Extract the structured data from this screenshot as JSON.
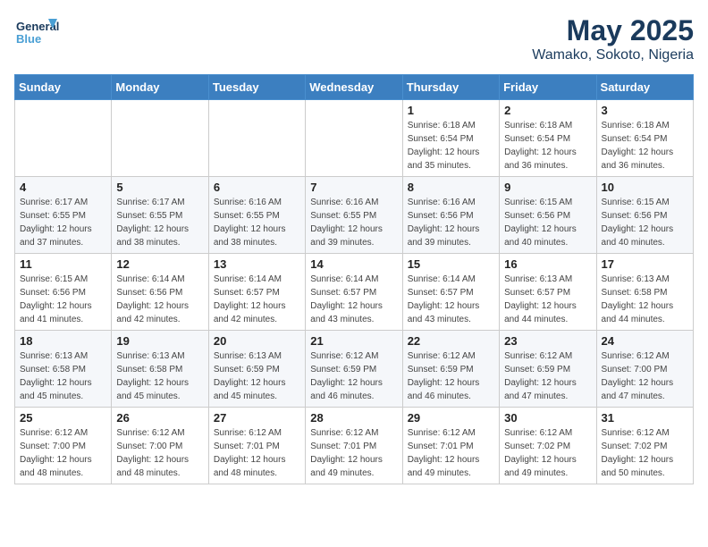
{
  "header": {
    "logo_general": "General",
    "logo_blue": "Blue",
    "month_year": "May 2025",
    "location": "Wamako, Sokoto, Nigeria"
  },
  "weekdays": [
    "Sunday",
    "Monday",
    "Tuesday",
    "Wednesday",
    "Thursday",
    "Friday",
    "Saturday"
  ],
  "weeks": [
    [
      {
        "day": "",
        "sunrise": "",
        "sunset": "",
        "daylight": ""
      },
      {
        "day": "",
        "sunrise": "",
        "sunset": "",
        "daylight": ""
      },
      {
        "day": "",
        "sunrise": "",
        "sunset": "",
        "daylight": ""
      },
      {
        "day": "",
        "sunrise": "",
        "sunset": "",
        "daylight": ""
      },
      {
        "day": "1",
        "sunrise": "Sunrise: 6:18 AM",
        "sunset": "Sunset: 6:54 PM",
        "daylight": "Daylight: 12 hours and 35 minutes."
      },
      {
        "day": "2",
        "sunrise": "Sunrise: 6:18 AM",
        "sunset": "Sunset: 6:54 PM",
        "daylight": "Daylight: 12 hours and 36 minutes."
      },
      {
        "day": "3",
        "sunrise": "Sunrise: 6:18 AM",
        "sunset": "Sunset: 6:54 PM",
        "daylight": "Daylight: 12 hours and 36 minutes."
      }
    ],
    [
      {
        "day": "4",
        "sunrise": "Sunrise: 6:17 AM",
        "sunset": "Sunset: 6:55 PM",
        "daylight": "Daylight: 12 hours and 37 minutes."
      },
      {
        "day": "5",
        "sunrise": "Sunrise: 6:17 AM",
        "sunset": "Sunset: 6:55 PM",
        "daylight": "Daylight: 12 hours and 38 minutes."
      },
      {
        "day": "6",
        "sunrise": "Sunrise: 6:16 AM",
        "sunset": "Sunset: 6:55 PM",
        "daylight": "Daylight: 12 hours and 38 minutes."
      },
      {
        "day": "7",
        "sunrise": "Sunrise: 6:16 AM",
        "sunset": "Sunset: 6:55 PM",
        "daylight": "Daylight: 12 hours and 39 minutes."
      },
      {
        "day": "8",
        "sunrise": "Sunrise: 6:16 AM",
        "sunset": "Sunset: 6:56 PM",
        "daylight": "Daylight: 12 hours and 39 minutes."
      },
      {
        "day": "9",
        "sunrise": "Sunrise: 6:15 AM",
        "sunset": "Sunset: 6:56 PM",
        "daylight": "Daylight: 12 hours and 40 minutes."
      },
      {
        "day": "10",
        "sunrise": "Sunrise: 6:15 AM",
        "sunset": "Sunset: 6:56 PM",
        "daylight": "Daylight: 12 hours and 40 minutes."
      }
    ],
    [
      {
        "day": "11",
        "sunrise": "Sunrise: 6:15 AM",
        "sunset": "Sunset: 6:56 PM",
        "daylight": "Daylight: 12 hours and 41 minutes."
      },
      {
        "day": "12",
        "sunrise": "Sunrise: 6:14 AM",
        "sunset": "Sunset: 6:56 PM",
        "daylight": "Daylight: 12 hours and 42 minutes."
      },
      {
        "day": "13",
        "sunrise": "Sunrise: 6:14 AM",
        "sunset": "Sunset: 6:57 PM",
        "daylight": "Daylight: 12 hours and 42 minutes."
      },
      {
        "day": "14",
        "sunrise": "Sunrise: 6:14 AM",
        "sunset": "Sunset: 6:57 PM",
        "daylight": "Daylight: 12 hours and 43 minutes."
      },
      {
        "day": "15",
        "sunrise": "Sunrise: 6:14 AM",
        "sunset": "Sunset: 6:57 PM",
        "daylight": "Daylight: 12 hours and 43 minutes."
      },
      {
        "day": "16",
        "sunrise": "Sunrise: 6:13 AM",
        "sunset": "Sunset: 6:57 PM",
        "daylight": "Daylight: 12 hours and 44 minutes."
      },
      {
        "day": "17",
        "sunrise": "Sunrise: 6:13 AM",
        "sunset": "Sunset: 6:58 PM",
        "daylight": "Daylight: 12 hours and 44 minutes."
      }
    ],
    [
      {
        "day": "18",
        "sunrise": "Sunrise: 6:13 AM",
        "sunset": "Sunset: 6:58 PM",
        "daylight": "Daylight: 12 hours and 45 minutes."
      },
      {
        "day": "19",
        "sunrise": "Sunrise: 6:13 AM",
        "sunset": "Sunset: 6:58 PM",
        "daylight": "Daylight: 12 hours and 45 minutes."
      },
      {
        "day": "20",
        "sunrise": "Sunrise: 6:13 AM",
        "sunset": "Sunset: 6:59 PM",
        "daylight": "Daylight: 12 hours and 45 minutes."
      },
      {
        "day": "21",
        "sunrise": "Sunrise: 6:12 AM",
        "sunset": "Sunset: 6:59 PM",
        "daylight": "Daylight: 12 hours and 46 minutes."
      },
      {
        "day": "22",
        "sunrise": "Sunrise: 6:12 AM",
        "sunset": "Sunset: 6:59 PM",
        "daylight": "Daylight: 12 hours and 46 minutes."
      },
      {
        "day": "23",
        "sunrise": "Sunrise: 6:12 AM",
        "sunset": "Sunset: 6:59 PM",
        "daylight": "Daylight: 12 hours and 47 minutes."
      },
      {
        "day": "24",
        "sunrise": "Sunrise: 6:12 AM",
        "sunset": "Sunset: 7:00 PM",
        "daylight": "Daylight: 12 hours and 47 minutes."
      }
    ],
    [
      {
        "day": "25",
        "sunrise": "Sunrise: 6:12 AM",
        "sunset": "Sunset: 7:00 PM",
        "daylight": "Daylight: 12 hours and 48 minutes."
      },
      {
        "day": "26",
        "sunrise": "Sunrise: 6:12 AM",
        "sunset": "Sunset: 7:00 PM",
        "daylight": "Daylight: 12 hours and 48 minutes."
      },
      {
        "day": "27",
        "sunrise": "Sunrise: 6:12 AM",
        "sunset": "Sunset: 7:01 PM",
        "daylight": "Daylight: 12 hours and 48 minutes."
      },
      {
        "day": "28",
        "sunrise": "Sunrise: 6:12 AM",
        "sunset": "Sunset: 7:01 PM",
        "daylight": "Daylight: 12 hours and 49 minutes."
      },
      {
        "day": "29",
        "sunrise": "Sunrise: 6:12 AM",
        "sunset": "Sunset: 7:01 PM",
        "daylight": "Daylight: 12 hours and 49 minutes."
      },
      {
        "day": "30",
        "sunrise": "Sunrise: 6:12 AM",
        "sunset": "Sunset: 7:02 PM",
        "daylight": "Daylight: 12 hours and 49 minutes."
      },
      {
        "day": "31",
        "sunrise": "Sunrise: 6:12 AM",
        "sunset": "Sunset: 7:02 PM",
        "daylight": "Daylight: 12 hours and 50 minutes."
      }
    ]
  ]
}
